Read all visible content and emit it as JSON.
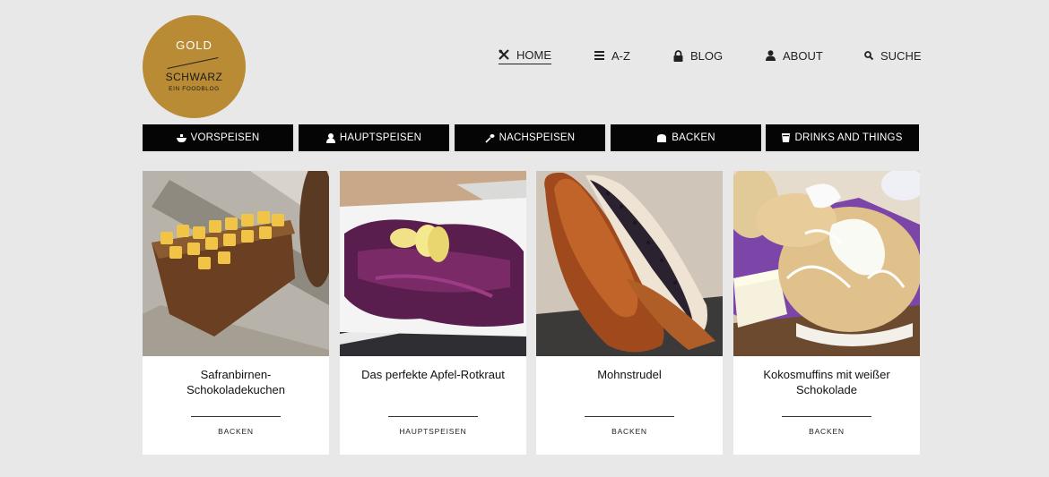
{
  "logo": {
    "line1": "GOLD",
    "line2": "SCHWARZ",
    "line3": "EIN FOODBLOG"
  },
  "nav": {
    "items": [
      {
        "label": "HOME",
        "icon": "cutlery-icon"
      },
      {
        "label": "A-Z",
        "icon": "list-icon"
      },
      {
        "label": "BLOG",
        "icon": "lock-icon"
      },
      {
        "label": "ABOUT",
        "icon": "person-icon"
      },
      {
        "label": "SUCHE",
        "icon": "search-icon"
      }
    ]
  },
  "categories": [
    {
      "label": "VORSPEISEN",
      "icon": "bowl-icon"
    },
    {
      "label": "HAUPTSPEISEN",
      "icon": "chef-icon"
    },
    {
      "label": "NACHSPEISEN",
      "icon": "whisk-icon"
    },
    {
      "label": "BACKEN",
      "icon": "bread-icon"
    },
    {
      "label": "DRINKS AND THINGS",
      "icon": "cup-icon"
    }
  ],
  "posts": [
    {
      "title_line1": "Safranbirnen-",
      "title_line2": "Schokoladekuchen",
      "category": "BACKEN"
    },
    {
      "title_line1": "Das perfekte Apfel-Rotkraut",
      "title_line2": "",
      "category": "HAUPTSPEISEN"
    },
    {
      "title_line1": "Mohnstrudel",
      "title_line2": "",
      "category": "BACKEN"
    },
    {
      "title_line1": "Kokosmuffins mit weißer",
      "title_line2": "Schokolade",
      "category": "BACKEN"
    }
  ],
  "colors": {
    "background": "#e8e8e8",
    "logo_gold": "#b98b34",
    "category_bar": "#050505"
  }
}
